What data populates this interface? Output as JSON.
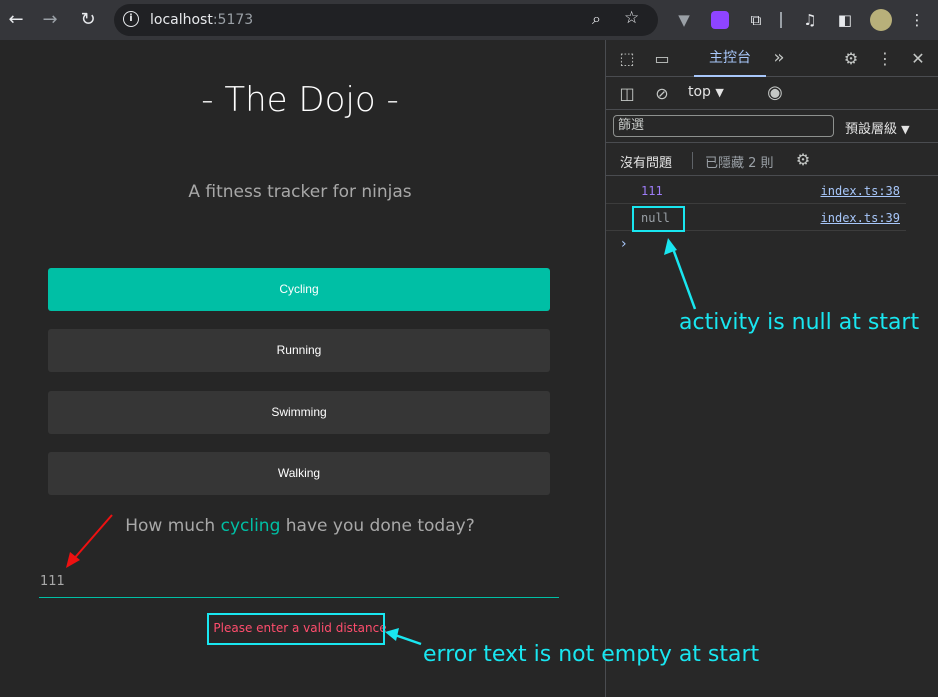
{
  "browser": {
    "url_host": "localhost",
    "url_port": ":5173",
    "icons": [
      "back-icon",
      "forward-icon",
      "reload-icon",
      "site-info-icon",
      "zoom-icon",
      "bookmark-star-icon",
      "extension-icon",
      "puzzle-icon",
      "media-icon",
      "side-panel-icon",
      "profile-avatar",
      "menu-icon"
    ]
  },
  "page": {
    "title": "- The Dojo -",
    "subtitle": "A fitness tracker for ninjas",
    "activities": [
      "Cycling",
      "Running",
      "Swimming",
      "Walking"
    ],
    "active_index": 0,
    "question_prefix": "How much ",
    "question_activity": "cycling",
    "question_suffix": " have you done today?",
    "distance_value": "111",
    "error_text": "Please enter a valid distance",
    "accent_color": "#00bfa5",
    "error_color": "#ff4d6d"
  },
  "devtools": {
    "tab_console": "主控台",
    "more_tabs": "»",
    "context": "top",
    "filter_placeholder": "篩選",
    "levels": "預設層級",
    "no_issues": "沒有問題",
    "hidden": "已隱藏 2 則",
    "logs": [
      {
        "value": "111",
        "source": "index.ts:38",
        "color": "#9d7cf7"
      },
      {
        "value": "null",
        "source": "index.ts:39",
        "color": "#9aa0a6"
      }
    ],
    "prompt": "›"
  },
  "annotations": {
    "null_note": "activity is null at start",
    "error_note": "error text is not empty at start",
    "color": "#19e6f0"
  }
}
